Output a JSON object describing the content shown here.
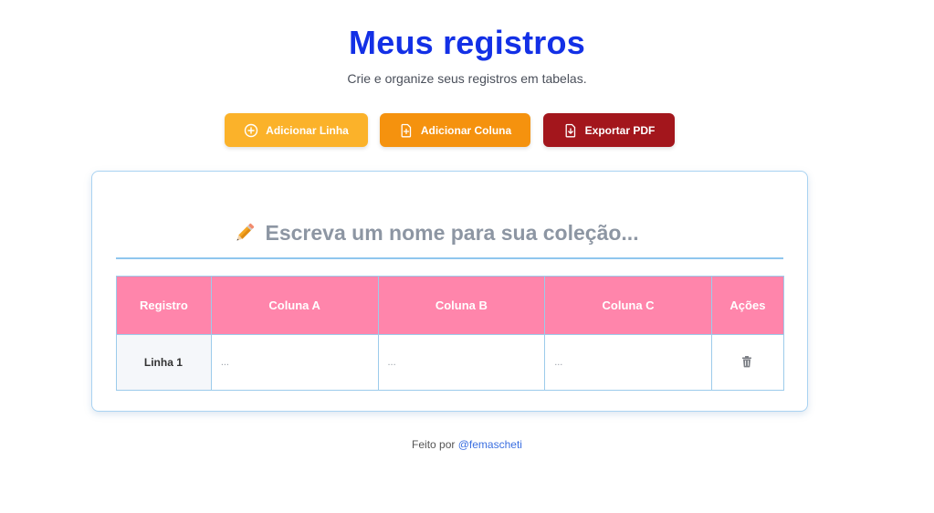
{
  "header": {
    "title": "Meus registros",
    "subtitle": "Crie e organize seus registros em tabelas."
  },
  "toolbar": {
    "add_row_label": "Adicionar Linha",
    "add_column_label": "Adicionar Coluna",
    "export_pdf_label": "Exportar PDF"
  },
  "collection": {
    "name_placeholder": "Escreva um nome para sua coleção...",
    "name_value": ""
  },
  "table": {
    "headers": [
      "Registro",
      "Coluna A",
      "Coluna B",
      "Coluna C",
      "Ações"
    ],
    "rows": [
      {
        "label": "Linha 1",
        "cells": [
          "...",
          "...",
          "..."
        ]
      }
    ]
  },
  "footer": {
    "prefix": "Feito por",
    "link": "@femascheti"
  },
  "colors": {
    "title": "#1330e6",
    "add_row": "#fbb22a",
    "add_column": "#f5920e",
    "export_pdf": "#a3161c",
    "table_header": "#ff85ab",
    "border": "#9ccbeb"
  }
}
